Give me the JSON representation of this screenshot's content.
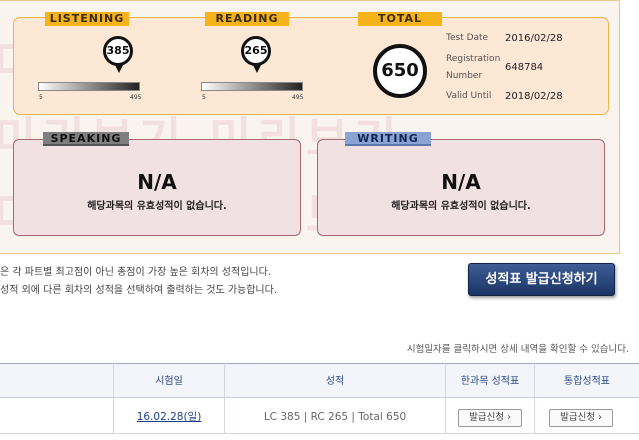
{
  "watermark_text": "미리보기 미리보기",
  "scores": {
    "listening": {
      "label": "LISTENING",
      "score": "385",
      "min": "5",
      "max": "495",
      "level": 0.7755
    },
    "reading": {
      "label": "READING",
      "score": "265",
      "min": "5",
      "max": "495",
      "level": 0.5306
    },
    "total": {
      "label": "TOTAL",
      "score": "650"
    }
  },
  "info": {
    "test_date_label": "Test Date",
    "test_date": "2016/02/28",
    "registration_label_1": "Registration",
    "registration_label_2": "Number",
    "registration_number": "648784",
    "valid_until_label": "Valid Until",
    "valid_until": "2018/02/28"
  },
  "speaking": {
    "label": "SPEAKING",
    "result": "N/A",
    "message": "해당과목의 유효성적이 없습니다."
  },
  "writing": {
    "label": "WRITING",
    "result": "N/A",
    "message": "해당과목의 유효성적이 없습니다."
  },
  "notes": {
    "line1": "은 각 파트별 최고점이 아닌 총점이 가장 높은 회차의 성적입니다.",
    "line2": "성적 외에 다른 회차의 성적을 선택하여 출력하는 것도 가능합니다."
  },
  "apply_button": "성적표 발급신청하기",
  "hint": "시험일자를 클릭하시면 상세 내역을 확인할 수 있습니다.",
  "table": {
    "headers": {
      "date": "시험일",
      "score": "성적",
      "single": "한과목 성적표",
      "combined": "통합성적표"
    },
    "rows": [
      {
        "date": "16.02.28(일)",
        "score": "LC 385 | RC 265 | Total 650",
        "single_btn": "발급신청 ›",
        "combined_btn": "발급신청 ›"
      }
    ]
  },
  "colors": {
    "card_bg": "#faf4ee",
    "panel_border": "#e9b64e",
    "tag_gold": "#f6b319",
    "lower_panel_border": "#a26b76",
    "button_blue": "#1b3465"
  }
}
